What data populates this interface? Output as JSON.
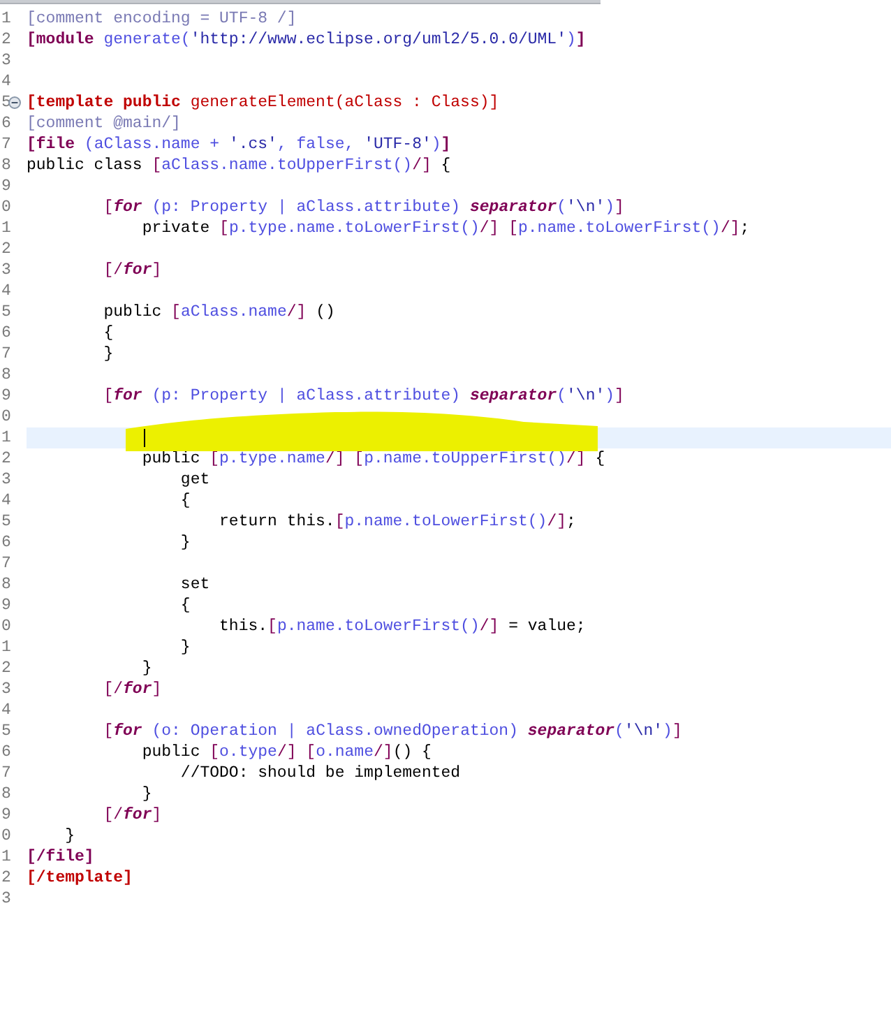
{
  "editor": {
    "lines": [
      {
        "number": "1",
        "current": false,
        "marked": false,
        "tokens": [
          {
            "kind": "comment",
            "text": "[comment encoding = UTF-8 /]"
          }
        ]
      },
      {
        "number": "2",
        "current": false,
        "marked": false,
        "tokens": [
          {
            "kind": "keyword",
            "text": "[module"
          },
          {
            "kind": "expr",
            "text": " generate("
          },
          {
            "kind": "string",
            "text": "'http://www.eclipse.org/uml2/5.0.0/UML'"
          },
          {
            "kind": "expr",
            "text": ")"
          },
          {
            "kind": "keyword",
            "text": "]"
          }
        ]
      },
      {
        "number": "3",
        "current": false,
        "marked": false
      },
      {
        "number": "4",
        "current": false,
        "marked": false
      },
      {
        "number": "5",
        "current": false,
        "marked": false,
        "fold_expanded": true,
        "tokens": [
          {
            "kind": "template",
            "text": "[template public"
          },
          {
            "kind": "template-plain",
            "text": " generateElement(aClass : Class)]"
          }
        ]
      },
      {
        "number": "6",
        "current": false,
        "marked": false,
        "tokens": [
          {
            "kind": "comment",
            "text": "[comment @main/]"
          }
        ]
      },
      {
        "number": "7",
        "current": false,
        "marked": false,
        "tokens": [
          {
            "kind": "keyword",
            "text": "[file"
          },
          {
            "kind": "expr",
            "text": " (aClass.name + "
          },
          {
            "kind": "string",
            "text": "'.cs'"
          },
          {
            "kind": "expr",
            "text": ", false, "
          },
          {
            "kind": "string",
            "text": "'UTF-8'"
          },
          {
            "kind": "expr",
            "text": ")"
          },
          {
            "kind": "keyword",
            "text": "]"
          }
        ]
      },
      {
        "number": "8",
        "current": false,
        "marked": false,
        "tokens": [
          {
            "kind": "plain",
            "text": "public class "
          },
          {
            "kind": "bracket",
            "text": "["
          },
          {
            "kind": "expr",
            "text": "aClass.name.toUpperFirst()"
          },
          {
            "kind": "bracket",
            "text": "/]"
          },
          {
            "kind": "plain",
            "text": " {"
          }
        ]
      },
      {
        "number": "9",
        "current": false,
        "marked": false
      },
      {
        "number": "0",
        "current": false,
        "marked": false,
        "tokens": [
          {
            "kind": "bracket",
            "text": "        ["
          },
          {
            "kind": "loop",
            "text": "for"
          },
          {
            "kind": "expr",
            "text": " (p: Property | aClass.attribute) "
          },
          {
            "kind": "loop",
            "text": "separator"
          },
          {
            "kind": "expr",
            "text": "("
          },
          {
            "kind": "string",
            "text": "'\\n'"
          },
          {
            "kind": "expr",
            "text": ")"
          },
          {
            "kind": "bracket",
            "text": "]"
          }
        ]
      },
      {
        "number": "1",
        "current": false,
        "marked": false,
        "tokens": [
          {
            "kind": "plain",
            "text": "            private "
          },
          {
            "kind": "bracket",
            "text": "["
          },
          {
            "kind": "expr",
            "text": "p.type.name.toLowerFirst()"
          },
          {
            "kind": "bracket",
            "text": "/]"
          },
          {
            "kind": "bracket",
            "text": " ["
          },
          {
            "kind": "expr",
            "text": "p.name.toLowerFirst()"
          },
          {
            "kind": "bracket",
            "text": "/]"
          },
          {
            "kind": "plain",
            "text": ";"
          }
        ]
      },
      {
        "number": "2",
        "current": false,
        "marked": false
      },
      {
        "number": "3",
        "current": false,
        "marked": false,
        "tokens": [
          {
            "kind": "bracket",
            "text": "        [/"
          },
          {
            "kind": "loop",
            "text": "for"
          },
          {
            "kind": "bracket",
            "text": "]"
          }
        ]
      },
      {
        "number": "4",
        "current": false,
        "marked": false
      },
      {
        "number": "5",
        "current": false,
        "marked": false,
        "tokens": [
          {
            "kind": "plain",
            "text": "        public "
          },
          {
            "kind": "bracket",
            "text": "["
          },
          {
            "kind": "expr",
            "text": "aClass.name"
          },
          {
            "kind": "bracket",
            "text": "/]"
          },
          {
            "kind": "plain",
            "text": " ()"
          }
        ]
      },
      {
        "number": "6",
        "current": false,
        "marked": false,
        "tokens": [
          {
            "kind": "plain",
            "text": "        {"
          }
        ]
      },
      {
        "number": "7",
        "current": false,
        "marked": false,
        "tokens": [
          {
            "kind": "plain",
            "text": "        }"
          }
        ]
      },
      {
        "number": "8",
        "current": false,
        "marked": false
      },
      {
        "number": "9",
        "current": false,
        "marked": false,
        "tokens": [
          {
            "kind": "bracket",
            "text": "        ["
          },
          {
            "kind": "loop",
            "text": "for"
          },
          {
            "kind": "expr",
            "text": " (p: Property | aClass.attribute) "
          },
          {
            "kind": "loop",
            "text": "separator"
          },
          {
            "kind": "expr",
            "text": "("
          },
          {
            "kind": "string",
            "text": "'\\n'"
          },
          {
            "kind": "expr",
            "text": ")"
          },
          {
            "kind": "bracket",
            "text": "]"
          }
        ]
      },
      {
        "number": "0",
        "current": false,
        "marked": false
      },
      {
        "number": "1",
        "current": true,
        "marked": true
      },
      {
        "number": "2",
        "current": false,
        "marked": false,
        "tokens": [
          {
            "kind": "plain",
            "text": "            public "
          },
          {
            "kind": "bracket",
            "text": "["
          },
          {
            "kind": "expr",
            "text": "p.type.name"
          },
          {
            "kind": "bracket",
            "text": "/]"
          },
          {
            "kind": "bracket",
            "text": " ["
          },
          {
            "kind": "expr",
            "text": "p.name.toUpperFirst()"
          },
          {
            "kind": "bracket",
            "text": "/]"
          },
          {
            "kind": "plain",
            "text": " {"
          }
        ]
      },
      {
        "number": "3",
        "current": false,
        "marked": false,
        "tokens": [
          {
            "kind": "plain",
            "text": "                get"
          }
        ]
      },
      {
        "number": "4",
        "current": false,
        "marked": false,
        "tokens": [
          {
            "kind": "plain",
            "text": "                {"
          }
        ]
      },
      {
        "number": "5",
        "current": false,
        "marked": false,
        "tokens": [
          {
            "kind": "plain",
            "text": "                    return this."
          },
          {
            "kind": "bracket",
            "text": "["
          },
          {
            "kind": "expr",
            "text": "p.name.toLowerFirst()"
          },
          {
            "kind": "bracket",
            "text": "/]"
          },
          {
            "kind": "plain",
            "text": ";"
          }
        ]
      },
      {
        "number": "6",
        "current": false,
        "marked": false,
        "tokens": [
          {
            "kind": "plain",
            "text": "                }"
          }
        ]
      },
      {
        "number": "7",
        "current": false,
        "marked": false
      },
      {
        "number": "8",
        "current": false,
        "marked": false,
        "tokens": [
          {
            "kind": "plain",
            "text": "                set"
          }
        ]
      },
      {
        "number": "9",
        "current": false,
        "marked": false,
        "tokens": [
          {
            "kind": "plain",
            "text": "                {"
          }
        ]
      },
      {
        "number": "0",
        "current": false,
        "marked": false,
        "tokens": [
          {
            "kind": "plain",
            "text": "                    this."
          },
          {
            "kind": "bracket",
            "text": "["
          },
          {
            "kind": "expr",
            "text": "p.name.toLowerFirst()"
          },
          {
            "kind": "bracket",
            "text": "/]"
          },
          {
            "kind": "plain",
            "text": " = value;"
          }
        ]
      },
      {
        "number": "1",
        "current": false,
        "marked": false,
        "tokens": [
          {
            "kind": "plain",
            "text": "                }"
          }
        ]
      },
      {
        "number": "2",
        "current": false,
        "marked": false,
        "tokens": [
          {
            "kind": "plain",
            "text": "            }"
          }
        ]
      },
      {
        "number": "3",
        "current": false,
        "marked": false,
        "tokens": [
          {
            "kind": "bracket",
            "text": "        [/"
          },
          {
            "kind": "loop",
            "text": "for"
          },
          {
            "kind": "bracket",
            "text": "]"
          }
        ]
      },
      {
        "number": "4",
        "current": false,
        "marked": false
      },
      {
        "number": "5",
        "current": false,
        "marked": false,
        "tokens": [
          {
            "kind": "bracket",
            "text": "        ["
          },
          {
            "kind": "loop",
            "text": "for"
          },
          {
            "kind": "expr",
            "text": " (o: Operation | aClass.ownedOperation) "
          },
          {
            "kind": "loop",
            "text": "separator"
          },
          {
            "kind": "expr",
            "text": "("
          },
          {
            "kind": "string",
            "text": "'\\n'"
          },
          {
            "kind": "expr",
            "text": ")"
          },
          {
            "kind": "bracket",
            "text": "]"
          }
        ]
      },
      {
        "number": "6",
        "current": false,
        "marked": false,
        "tokens": [
          {
            "kind": "plain",
            "text": "            public "
          },
          {
            "kind": "bracket",
            "text": "["
          },
          {
            "kind": "expr",
            "text": "o.type"
          },
          {
            "kind": "bracket",
            "text": "/]"
          },
          {
            "kind": "bracket",
            "text": " ["
          },
          {
            "kind": "expr",
            "text": "o.name"
          },
          {
            "kind": "bracket",
            "text": "/]"
          },
          {
            "kind": "plain",
            "text": "() {"
          }
        ]
      },
      {
        "number": "7",
        "current": false,
        "marked": false,
        "tokens": [
          {
            "kind": "plain",
            "text": "                //TODO: should be implemented"
          }
        ]
      },
      {
        "number": "8",
        "current": false,
        "marked": false,
        "tokens": [
          {
            "kind": "plain",
            "text": "            }"
          }
        ]
      },
      {
        "number": "9",
        "current": false,
        "marked": false,
        "tokens": [
          {
            "kind": "bracket",
            "text": "        [/"
          },
          {
            "kind": "loop",
            "text": "for"
          },
          {
            "kind": "bracket",
            "text": "]"
          }
        ]
      },
      {
        "number": "0",
        "current": false,
        "marked": false,
        "tokens": [
          {
            "kind": "plain",
            "text": "    }"
          }
        ]
      },
      {
        "number": "1",
        "current": false,
        "marked": false,
        "tokens": [
          {
            "kind": "keyword",
            "text": "[/file]"
          }
        ]
      },
      {
        "number": "2",
        "current": false,
        "marked": false,
        "tokens": [
          {
            "kind": "template",
            "text": "[/template]"
          }
        ]
      },
      {
        "number": "3",
        "current": false,
        "marked": false
      }
    ]
  }
}
